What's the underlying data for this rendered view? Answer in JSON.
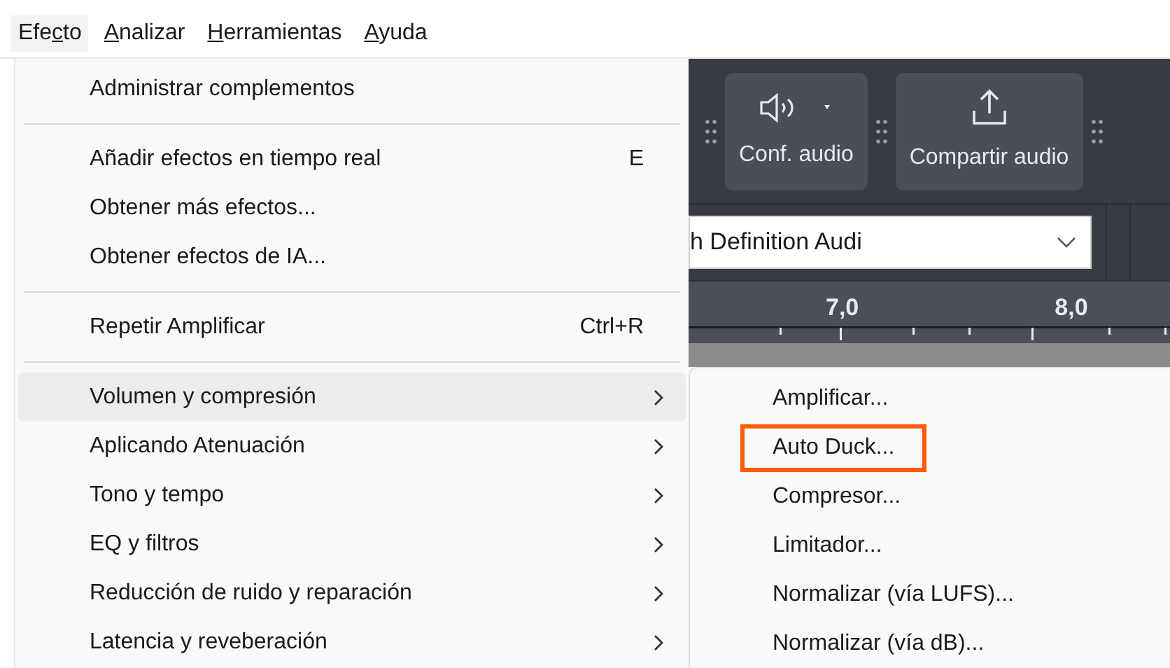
{
  "menu_bar": [
    {
      "before": "Efe",
      "access_key": "c",
      "after": "to",
      "selected": true
    },
    {
      "access_key": "A",
      "after": "nalizar",
      "selected": false
    },
    {
      "access_key": "H",
      "after": "erramientas",
      "selected": false
    },
    {
      "access_key": "A",
      "after": "yuda",
      "selected": false
    }
  ],
  "toolbar": {
    "buttons": [
      {
        "label": "Conf. audio",
        "kind": "speaker"
      },
      {
        "label": "Compartir audio",
        "kind": "share"
      }
    ],
    "device_select": {
      "value": "h Definition Audi"
    },
    "ruler": {
      "labels": [
        "7,0",
        "8,0"
      ]
    }
  },
  "menu": [
    {
      "kind": "item",
      "label": "Administrar complementos",
      "selected": false
    },
    {
      "kind": "separator"
    },
    {
      "kind": "item",
      "label": "Añadir efectos en tiempo real",
      "shortcut": "E",
      "selected": false
    },
    {
      "kind": "item",
      "label": "Obtener más efectos...",
      "selected": false
    },
    {
      "kind": "item",
      "label": "Obtener efectos de IA...",
      "selected": false
    },
    {
      "kind": "separator"
    },
    {
      "kind": "item",
      "label": "Repetir Amplificar",
      "shortcut": "Ctrl+R",
      "selected": false
    },
    {
      "kind": "separator"
    },
    {
      "kind": "submenu",
      "label": "Volumen y compresión",
      "selected": true
    },
    {
      "kind": "submenu",
      "label": "Aplicando Atenuación",
      "selected": false
    },
    {
      "kind": "submenu",
      "label": "Tono y tempo",
      "selected": false
    },
    {
      "kind": "submenu",
      "label": "EQ y filtros",
      "selected": false
    },
    {
      "kind": "submenu",
      "label": "Reducción de ruido y reparación",
      "selected": false
    },
    {
      "kind": "submenu",
      "label": "Latencia y reveberación",
      "selected": false
    }
  ],
  "submenu": [
    {
      "label": "Amplificar...",
      "outlined": false
    },
    {
      "label": "Auto Duck...",
      "outlined": true
    },
    {
      "label": "Compresor...",
      "outlined": false
    },
    {
      "label": "Limitador...",
      "outlined": false
    },
    {
      "label": "Normalizar (vía LUFS)...",
      "outlined": false
    },
    {
      "label": "Normalizar (vía dB)...",
      "outlined": false
    }
  ]
}
